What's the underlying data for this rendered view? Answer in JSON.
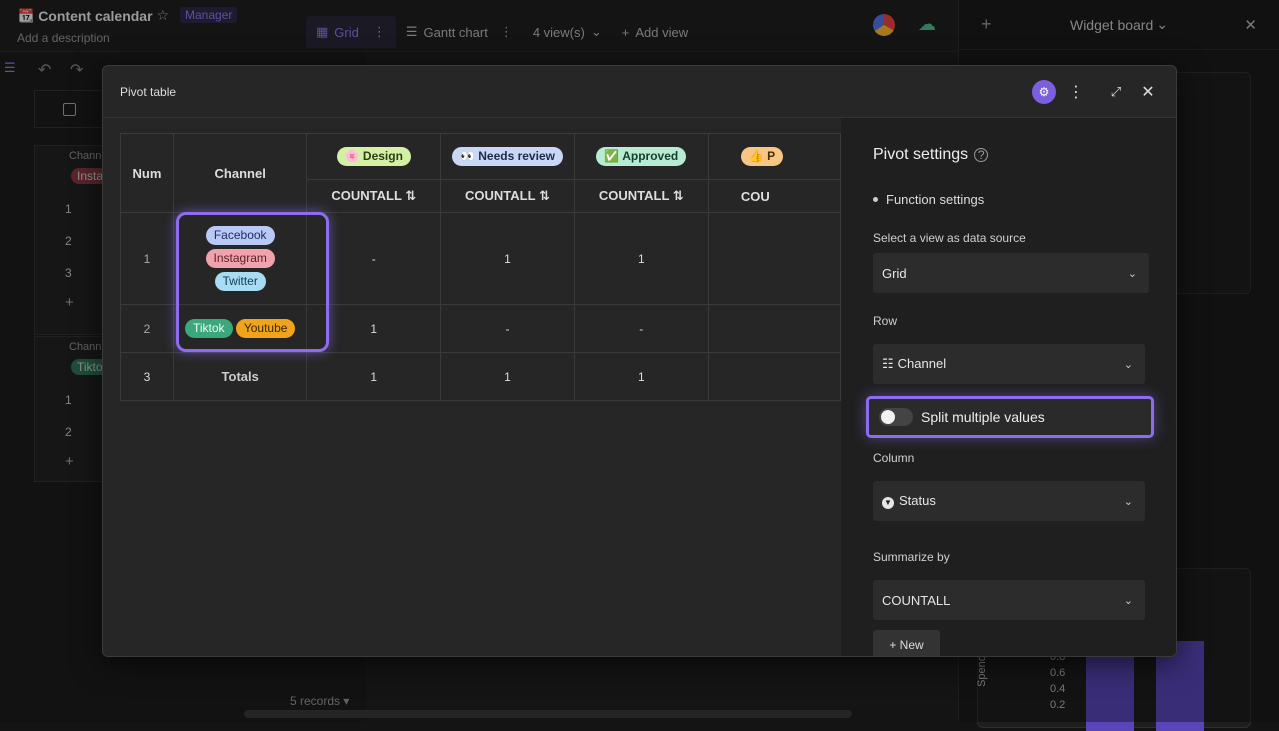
{
  "app": {
    "title": "Content calendar",
    "role_badge": "Manager",
    "description": "Add a description"
  },
  "view_tabs": [
    {
      "label": "Grid"
    },
    {
      "label": "Gantt chart"
    },
    {
      "label": "4 view(s)"
    },
    {
      "label": "Add view"
    }
  ],
  "right_pane": {
    "title": "Widget board",
    "chart_ylabel": "Spend tim",
    "chart_ticks": [
      "0.8",
      "0.6",
      "0.4",
      "0.2"
    ]
  },
  "left_grid": {
    "groups": [
      {
        "label": "Chann",
        "tag": "Insta",
        "rows": [
          "1",
          "2",
          "3"
        ]
      },
      {
        "label": "Chann",
        "tag": "Tikto",
        "rows": [
          "1",
          "2"
        ]
      }
    ],
    "records": "5 records"
  },
  "modal": {
    "title": "Pivot table",
    "table": {
      "headers": {
        "num": "Num",
        "channel": "Channel"
      },
      "status_columns": [
        {
          "label": "Design",
          "emoji": "🌸",
          "agg": "COUNTALL"
        },
        {
          "label": "Needs review",
          "emoji": "👀",
          "agg": "COUNTALL"
        },
        {
          "label": "Approved",
          "emoji": "✅",
          "agg": "COUNTALL"
        },
        {
          "label": "P",
          "emoji": "👍",
          "agg": "COU"
        }
      ],
      "rows": [
        {
          "num": "1",
          "channels": [
            "Facebook",
            "Instagram",
            "Twitter"
          ],
          "values": [
            "-",
            "1",
            "1",
            ""
          ]
        },
        {
          "num": "2",
          "channels": [
            "Tiktok",
            "Youtube"
          ],
          "values": [
            "1",
            "-",
            "-",
            ""
          ]
        },
        {
          "num": "3",
          "channel_text": "Totals",
          "values": [
            "1",
            "1",
            "1",
            ""
          ]
        }
      ]
    },
    "settings": {
      "title": "Pivot settings",
      "function_settings": "Function settings",
      "data_source_label": "Select a view as data source",
      "data_source_value": "Grid",
      "row_label": "Row",
      "row_value": "Channel",
      "split_label": "Split multiple values",
      "column_label": "Column",
      "column_value": "Status",
      "summarize_label": "Summarize by",
      "summarize_value": "COUNTALL",
      "new_button": "+ New"
    }
  }
}
